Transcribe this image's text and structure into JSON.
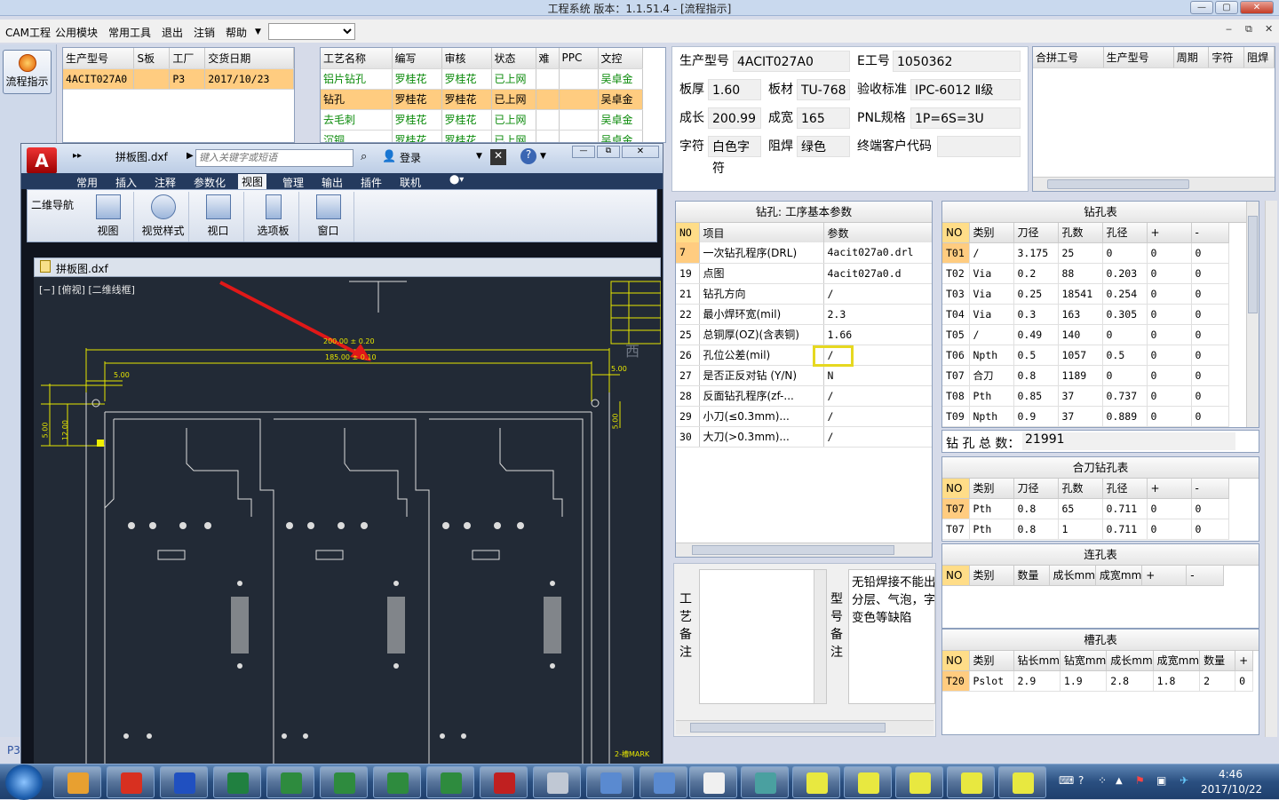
{
  "window": {
    "title": "工程系统   版本：1.1.51.4 - [流程指示]",
    "controls": [
      "—",
      "▢",
      "✕"
    ]
  },
  "menu": {
    "items": [
      "CAM工程",
      "公用模块",
      "常用工具",
      "退出",
      "注销",
      "帮助"
    ],
    "mdi_controls": [
      "‒",
      "⧉",
      "✕"
    ]
  },
  "leftnav": {
    "button_label": "流程指示",
    "status_text": "P3"
  },
  "order_grid": {
    "headers": [
      "生产型号",
      "S板",
      "工厂",
      "交货日期"
    ],
    "rows": [
      [
        "4ACIT027A0",
        "",
        "P3",
        "2017/10/23"
      ]
    ]
  },
  "process_grid": {
    "headers": [
      "工艺名称",
      "编写",
      "审核",
      "状态",
      "难",
      "PPC",
      "文控"
    ],
    "rows": [
      [
        "铝片钻孔",
        "罗桂花",
        "罗桂花",
        "已上网",
        "",
        "",
        "吴卓金"
      ],
      [
        "钻孔",
        "罗桂花",
        "罗桂花",
        "已上网",
        "",
        "",
        "吴卓金"
      ],
      [
        "去毛刺",
        "罗桂花",
        "罗桂花",
        "已上网",
        "",
        "",
        "吴卓金"
      ],
      [
        "沉铜",
        "罗桂花",
        "罗桂花",
        "已上网",
        "",
        "",
        "吴卓金"
      ]
    ]
  },
  "info": {
    "model_label": "生产型号",
    "model": "4ACIT027A0",
    "eno_label": "E工号",
    "eno": "1050362",
    "thick_label": "板厚",
    "thick": "1.60",
    "mat_label": "板材",
    "mat": "TU-768",
    "std_label": "验收标准",
    "std": "IPC-6012 Ⅱ级",
    "len_label": "成长",
    "len": "200.99",
    "wid_label": "成宽",
    "wid": "165",
    "pnl_label": "PNL规格",
    "pnl": "1P=6S=3U",
    "char_label": "字符",
    "char": "白色字符",
    "mask_label": "阻焊",
    "mask": "绿色",
    "cust_label": "终端客户代码",
    "cust": ""
  },
  "merge_grid": {
    "headers": [
      "合拼工号",
      "生产型号",
      "周期",
      "字符",
      "阻焊"
    ]
  },
  "params": {
    "title": "钻孔: 工序基本参数",
    "headers": [
      "NO",
      "项目",
      "参数"
    ],
    "rows": [
      [
        "7",
        "一次钻孔程序(DRL)",
        "4acit027a0.drl"
      ],
      [
        "19",
        "点图",
        "4acit027a0.d"
      ],
      [
        "21",
        "钻孔方向",
        "/"
      ],
      [
        "22",
        "最小焊环宽(mil)",
        "2.3"
      ],
      [
        "25",
        "总铜厚(OZ)(含表铜)",
        "1.66"
      ],
      [
        "26",
        "孔位公差(mil)",
        "/"
      ],
      [
        "27",
        "是否正反对钻 (Y/N)",
        "N"
      ],
      [
        "28",
        "反面钻孔程序(zf-...",
        "/"
      ],
      [
        "29",
        "小刀(≤0.3mm)...",
        "/"
      ],
      [
        "30",
        "大刀(>0.3mm)...",
        "/"
      ]
    ]
  },
  "remarks": {
    "process_label": [
      "工",
      "艺",
      "备",
      "注"
    ],
    "model_label": [
      "型",
      "号",
      "备",
      "注"
    ],
    "model_text": [
      "无铅焊接不能出",
      "分层、气泡，字",
      "变色等缺陷"
    ]
  },
  "drill_table": {
    "title": "钻孔表",
    "headers": [
      "NO",
      "类别",
      "刀径",
      "孔数",
      "孔径",
      "+",
      "-"
    ],
    "rows": [
      [
        "T01",
        "/",
        "3.175",
        "25",
        "0",
        "0",
        "0"
      ],
      [
        "T02",
        "Via",
        "0.2",
        "88",
        "0.203",
        "0",
        "0"
      ],
      [
        "T03",
        "Via",
        "0.25",
        "18541",
        "0.254",
        "0",
        "0"
      ],
      [
        "T04",
        "Via",
        "0.3",
        "163",
        "0.305",
        "0",
        "0"
      ],
      [
        "T05",
        "/",
        "0.49",
        "140",
        "0",
        "0",
        "0"
      ],
      [
        "T06",
        "Npth",
        "0.5",
        "1057",
        "0.5",
        "0",
        "0"
      ],
      [
        "T07",
        "合刀",
        "0.8",
        "1189",
        "0",
        "0",
        "0"
      ],
      [
        "T08",
        "Pth",
        "0.85",
        "37",
        "0.737",
        "0",
        "0"
      ],
      [
        "T09",
        "Npth",
        "0.9",
        "37",
        "0.889",
        "0",
        "0"
      ]
    ],
    "total_label": "钻 孔 总 数：",
    "total": "21991"
  },
  "merge_drill": {
    "title": "合刀钻孔表",
    "headers": [
      "NO",
      "类别",
      "刀径",
      "孔数",
      "孔径",
      "+",
      "-"
    ],
    "rows": [
      [
        "T07",
        "Pth",
        "0.8",
        "65",
        "0.711",
        "0",
        "0"
      ],
      [
        "T07",
        "Pth",
        "0.8",
        "1",
        "0.711",
        "0",
        "0"
      ]
    ]
  },
  "link_holes": {
    "title": "连孔表",
    "headers": [
      "NO",
      "类别",
      "数量",
      "成长mm",
      "成宽mm",
      "+",
      "-"
    ]
  },
  "slot_holes": {
    "title": "槽孔表",
    "headers": [
      "NO",
      "类别",
      "钻长mm",
      "钻宽mm",
      "成长mm",
      "成宽mm",
      "数量",
      "+"
    ],
    "rows": [
      [
        "T20",
        "Pslot",
        "2.9",
        "1.9",
        "2.8",
        "1.8",
        "2",
        "0"
      ]
    ]
  },
  "cad": {
    "filename": "拼板图.dxf",
    "search_placeholder": "键入关键字或短语",
    "login": "登录",
    "tabs": [
      "常用",
      "插入",
      "注释",
      "参数化",
      "视图",
      "管理",
      "输出",
      "插件",
      "联机"
    ],
    "nav_label": "二维导航",
    "ribbon_buttons": [
      "视图",
      "视觉样式",
      "视口",
      "选项板",
      "窗口"
    ],
    "doc_tab": "拼板图.dxf",
    "viewport_label": "[−] [俯视] [二维线框]",
    "dim_top1": "200.00 ± 0.20",
    "dim_top2": "185.00 ± 0.10",
    "dim_left": "5.00",
    "dim_right": "5.00",
    "dim_v1": "5.00",
    "dim_v2": "12.00",
    "dim_v3": "5.00",
    "compass": "西",
    "corner_note": "2-槽MARK"
  },
  "clock": {
    "time": "4:46",
    "date": "2017/10/22"
  },
  "colors": {
    "accent": "#ffcc80",
    "green_text": "#0a8a0a",
    "cad_bg": "#222a36",
    "dim_yellow": "#e6e600",
    "highlight_box": "#e6d820"
  }
}
